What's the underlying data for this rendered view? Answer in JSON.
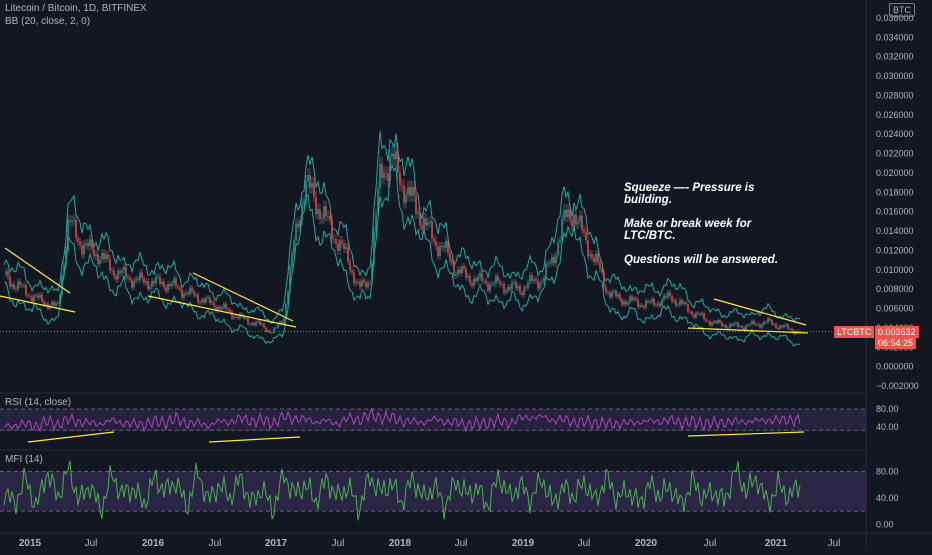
{
  "header": {
    "symbol_title": "Litecoin / Bitcoin, 1D, BITFINEX",
    "overlay_label": "BB (20, close, 2, 0)",
    "currency_badge": "BTC"
  },
  "price_tag": {
    "ticker": "LTCBTC",
    "value": "0.003632",
    "countdown": "06:54:25",
    "color": "#ef5350"
  },
  "annotation": {
    "lines": [
      "Squeeze —- Pressure is building.",
      "Make or break week for LTC/BTC.",
      "Questions will be answered."
    ]
  },
  "rsi_panel": {
    "label": "RSI (14, close)",
    "ticks": [
      "80.00",
      "40.00"
    ],
    "band_color": "#7e57c2",
    "line_color": "#ab47bc"
  },
  "mfi_panel": {
    "label": "MFI (14)",
    "ticks": [
      "80.00",
      "40.00",
      "0.00"
    ],
    "band_color": "#7e57c2",
    "line_color": "#4caf50"
  },
  "time_axis": {
    "labels": [
      "2015",
      "Jul",
      "2016",
      "Jul",
      "2017",
      "Jul",
      "2018",
      "Jul",
      "2019",
      "Jul",
      "2020",
      "Jul",
      "2021",
      "Jul"
    ]
  },
  "colors": {
    "background": "#131722",
    "bb_band": "#26a69a",
    "candle_up": "#26a69a",
    "candle_down": "#ef5350",
    "trendline": "#ffeb3b"
  },
  "chart_data": [
    {
      "type": "line",
      "title": "Litecoin / Bitcoin, 1D, BITFINEX",
      "x": [
        "2015-01",
        "2015-02",
        "2015-03",
        "2015-04",
        "2015-05",
        "2015-06",
        "2015-07",
        "2015-08",
        "2015-09",
        "2015-10",
        "2015-11",
        "2015-12",
        "2016-01",
        "2016-02",
        "2016-03",
        "2016-04",
        "2016-05",
        "2016-06",
        "2016-07",
        "2016-08",
        "2016-09",
        "2016-10",
        "2016-11",
        "2016-12",
        "2017-01",
        "2017-02",
        "2017-03",
        "2017-04",
        "2017-05",
        "2017-06",
        "2017-07",
        "2017-08",
        "2017-09",
        "2017-10",
        "2017-11",
        "2017-12",
        "2018-01",
        "2018-02",
        "2018-03",
        "2018-04",
        "2018-05",
        "2018-06",
        "2018-07",
        "2018-08",
        "2018-09",
        "2018-10",
        "2018-11",
        "2018-12",
        "2019-01",
        "2019-02",
        "2019-03",
        "2019-04",
        "2019-05",
        "2019-06",
        "2019-07",
        "2019-08",
        "2019-09",
        "2019-10",
        "2019-11",
        "2019-12",
        "2020-01",
        "2020-02",
        "2020-03",
        "2020-04",
        "2020-05",
        "2020-06",
        "2020-07",
        "2020-08",
        "2020-09",
        "2020-10",
        "2020-11",
        "2020-12",
        "2021-01",
        "2021-02",
        "2021-03"
      ],
      "series": [
        {
          "values": [
            0.0094,
            0.0085,
            0.0078,
            0.007,
            0.0066,
            0.006,
            0.015,
            0.013,
            0.012,
            0.0115,
            0.01,
            0.0095,
            0.009,
            0.0088,
            0.0087,
            0.0086,
            0.0082,
            0.0076,
            0.0072,
            0.0066,
            0.0062,
            0.0056,
            0.005,
            0.0046,
            0.0042,
            0.0035,
            0.005,
            0.013,
            0.019,
            0.017,
            0.015,
            0.013,
            0.011,
            0.008,
            0.009,
            0.02,
            0.0215,
            0.019,
            0.017,
            0.015,
            0.013,
            0.012,
            0.01,
            0.0093,
            0.0089,
            0.0087,
            0.0085,
            0.0082,
            0.008,
            0.0087,
            0.009,
            0.011,
            0.015,
            0.016,
            0.013,
            0.011,
            0.008,
            0.007,
            0.0068,
            0.0066,
            0.0064,
            0.0068,
            0.0072,
            0.0064,
            0.0056,
            0.005,
            0.0045,
            0.0043,
            0.0042,
            0.0042,
            0.0044,
            0.0046,
            0.0042,
            0.0039,
            0.0036
          ]
        }
      ],
      "ylim": [
        -0.002,
        0.036
      ],
      "y_ticks": [
        "0.036000",
        "0.034000",
        "0.032000",
        "0.030000",
        "0.028000",
        "0.026000",
        "0.024000",
        "0.022000",
        "0.020000",
        "0.018000",
        "0.016000",
        "0.014000",
        "0.012000",
        "0.010000",
        "0.008000",
        "0.006000",
        "0.004000",
        "0.002000",
        "0.000000",
        "−0.002000"
      ],
      "last_value": 0.003632,
      "grid": false
    },
    {
      "type": "line",
      "title": "RSI (14, close)",
      "series": [
        {
          "values": [
            45,
            40,
            50,
            38,
            55,
            42,
            60,
            48,
            52,
            44,
            58,
            46,
            50,
            42,
            55,
            47,
            61,
            45,
            52,
            40,
            56,
            48,
            62,
            50,
            58,
            45,
            66,
            55,
            60,
            48,
            57,
            44,
            63,
            52,
            70,
            58,
            64,
            50,
            55,
            47,
            61,
            49,
            53,
            42,
            50,
            46,
            57,
            45,
            63,
            58,
            66,
            52,
            60,
            48,
            54,
            46,
            50,
            44,
            52,
            48,
            56,
            50,
            58,
            47,
            53,
            45,
            51,
            47,
            55,
            49,
            57,
            52,
            58,
            54,
            56
          ]
        }
      ],
      "ylim": [
        0,
        100
      ],
      "y_ticks": [
        "80.00",
        "40.00"
      ]
    },
    {
      "type": "line",
      "title": "MFI (14)",
      "series": [
        {
          "values": [
            50,
            30,
            70,
            25,
            80,
            40,
            85,
            35,
            60,
            20,
            75,
            45,
            55,
            30,
            70,
            50,
            65,
            25,
            80,
            35,
            60,
            40,
            70,
            30,
            55,
            20,
            75,
            45,
            60,
            35,
            68,
            40,
            58,
            22,
            72,
            48,
            62,
            33,
            70,
            38,
            58,
            26,
            66,
            44,
            54,
            28,
            74,
            40,
            60,
            36,
            70,
            30,
            56,
            42,
            64,
            34,
            72,
            38,
            52,
            30,
            60,
            44,
            56,
            28,
            66,
            40,
            50,
            34,
            84,
            50,
            70,
            30,
            60,
            40,
            62
          ]
        }
      ],
      "ylim": [
        -10,
        100
      ],
      "y_ticks": [
        "80.00",
        "40.00",
        "0.00"
      ]
    }
  ]
}
